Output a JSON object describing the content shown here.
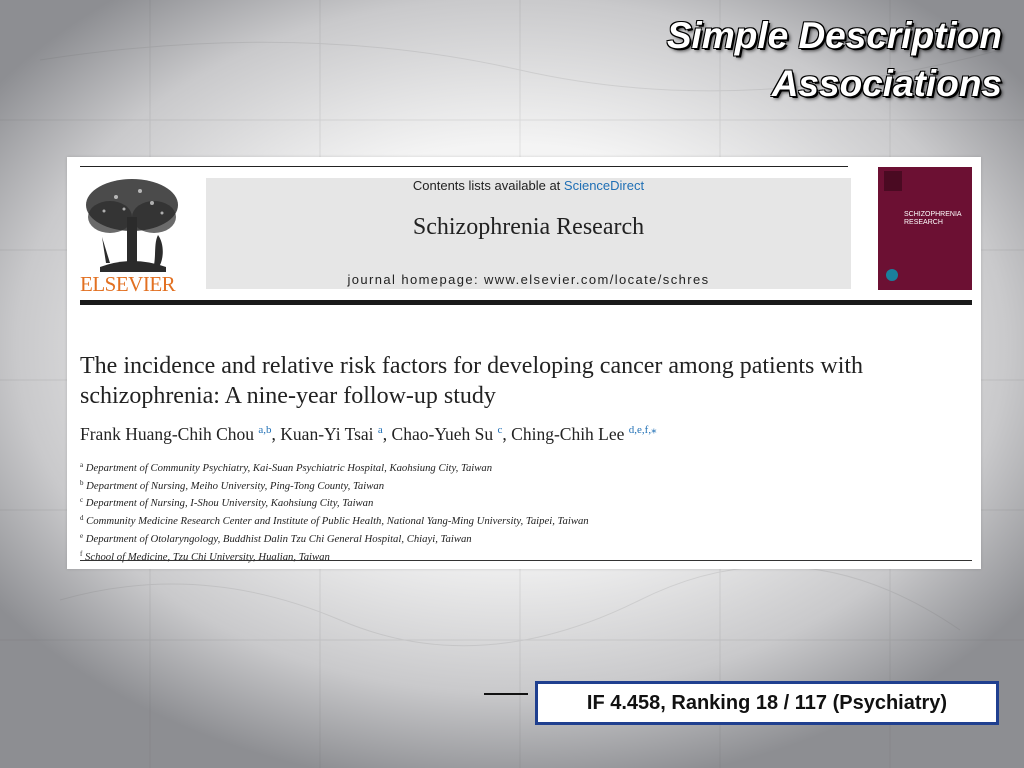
{
  "slide": {
    "title_line1": "Simple Description",
    "title_line2": "Associations"
  },
  "journal_header": {
    "contents_prefix": "Contents lists available at ",
    "contents_link": "ScienceDirect",
    "journal_name": "Schizophrenia Research",
    "homepage": "journal homepage: www.elsevier.com/locate/schres",
    "publisher_logo_text": "ELSEVIER",
    "cover_title_line1": "SCHIZOPHRENIA",
    "cover_title_line2": "RESEARCH"
  },
  "article": {
    "title": "The incidence and relative risk factors for developing cancer among patients with schizophrenia: A nine-year follow-up study",
    "authors": [
      {
        "name": "Frank Huang-Chih Chou ",
        "sup": "a,b",
        "sep": ", "
      },
      {
        "name": "Kuan-Yi Tsai ",
        "sup": "a",
        "sep": ", "
      },
      {
        "name": "Chao-Yueh Su ",
        "sup": "c",
        "sep": ", "
      },
      {
        "name": "Ching-Chih Lee ",
        "sup": "d,e,f,",
        "sep": ""
      }
    ],
    "corresponding_mark": "⁎",
    "affiliations": [
      {
        "key": "a",
        "text": "Department of Community Psychiatry, Kai-Suan Psychiatric Hospital, Kaohsiung City, Taiwan"
      },
      {
        "key": "b",
        "text": "Department of Nursing, Meiho University, Ping-Tong County, Taiwan"
      },
      {
        "key": "c",
        "text": "Department of Nursing, I-Shou University, Kaohsiung City, Taiwan"
      },
      {
        "key": "d",
        "text": "Community Medicine Research Center and Institute of Public Health, National Yang-Ming University, Taipei, Taiwan"
      },
      {
        "key": "e",
        "text": "Department of Otolaryngology, Buddhist Dalin Tzu Chi General Hospital, Chiayi, Taiwan"
      },
      {
        "key": "f",
        "text": "School of Medicine, Tzu Chi University, Hualian, Taiwan"
      }
    ]
  },
  "impact_box": {
    "text": "IF 4.458, Ranking 18 / 117 (Psychiatry)"
  },
  "colors": {
    "elsevier_orange": "#e27021",
    "sciencedirect_blue": "#1f6fb5",
    "cover_maroon": "#6c1033",
    "box_border": "#1f3f8f"
  }
}
